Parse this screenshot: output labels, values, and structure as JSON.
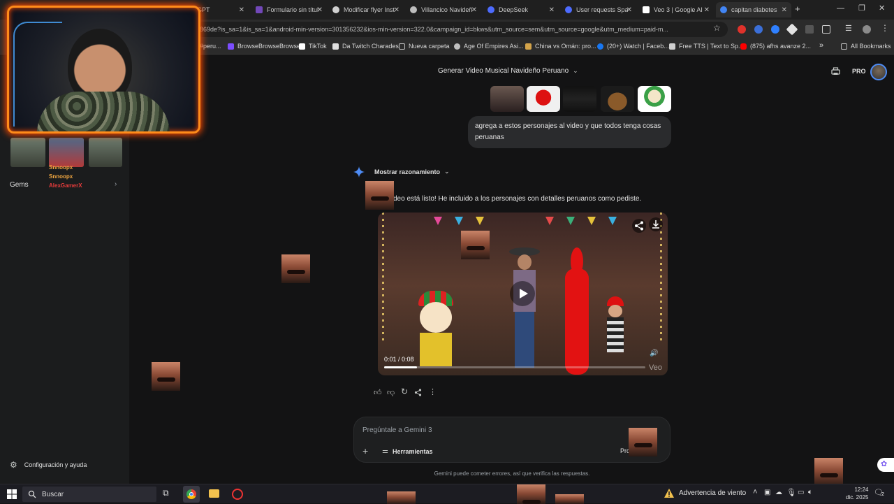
{
  "tabs": [
    {
      "title": "GPT",
      "color": "#444444"
    },
    {
      "title": "Formulario sin título",
      "color": "#7248b9"
    },
    {
      "title": "Modificar flyer Instagram",
      "color": "#d0d0d0"
    },
    {
      "title": "Villancico Navideño",
      "color": "#bdbdbd"
    },
    {
      "title": "DeepSeek",
      "color": "#4d6bfe"
    },
    {
      "title": "User requests Spanish",
      "color": "#4d6bfe"
    },
    {
      "title": "Veo 3 | Google AI",
      "color": "#ffffff"
    },
    {
      "title": "capitan diabetes",
      "color": "#4285f4"
    }
  ],
  "new_tab": "+",
  "address": "869de?is_sa=1&is_sa=1&android-min-version=301356232&ios-min-version=322.0&campaign_id=bkws&utm_source=sem&utm_source=google&utm_medium=paid-m...",
  "bookmarks": [
    {
      "label": "#peru...",
      "color": "#888888"
    },
    {
      "label": "BrowseBrowseBrowse",
      "color": "#7c4dff"
    },
    {
      "label": "TikTok",
      "color": "#ffffff"
    },
    {
      "label": "Da Twitch Charades",
      "color": "#e0e0e0"
    },
    {
      "label": "Nueva carpeta",
      "color": "#bdbdbd"
    },
    {
      "label": "Age Of Empires Asi...",
      "color": "#c0c0c0"
    },
    {
      "label": "China vs Omán: pro...",
      "color": "#d3a34a"
    },
    {
      "label": "(20+) Watch | Faceb...",
      "color": "#1877f2"
    },
    {
      "label": "Free TTS | Text to Sp...",
      "color": "#cfcfcf"
    },
    {
      "label": "(875) afhs avanze 2...",
      "color": "#ff0000"
    }
  ],
  "bookmarks_more": "»",
  "all_bookmarks": "All Bookmarks",
  "sidebar": {
    "gems_label": "Gems",
    "settings_label": "Configuración y ayuda",
    "chat_overlay": [
      {
        "name": "Snnoopx",
        "color": "#f0a640"
      },
      {
        "name": "Snnoopx",
        "color": "#f0a640"
      },
      {
        "name": "AlexGamerX",
        "color": "#e33b3b"
      }
    ]
  },
  "header": {
    "title": "Generar Video Musical Navideño Peruano",
    "pro_label": "PRO"
  },
  "conversation": {
    "user_message": "agrega a estos personajes al video y que todos tenga cosas peruanas",
    "reasoning_toggle": "Mostrar razonamiento",
    "response": "deo está listo! He incluido a los personajes con detalles peruanos como pediste.",
    "video": {
      "time": "0:01 / 0:08",
      "progress": 0.125,
      "watermark": "Veo"
    }
  },
  "input": {
    "placeholder": "Pregúntale a Gemini 3",
    "tools_label": "Herramientas",
    "mode_label": "Pro"
  },
  "disclaimer": "Gemini puede cometer errores, así que verifica las respuestas.",
  "taskbar": {
    "search_label": "Buscar",
    "weather_label": "Advertencia de viento",
    "time": "12:24",
    "date": "dic. 2025",
    "notif_count": "2"
  },
  "colors": {
    "accent_orange": "#ff8c1a",
    "gemini_blue": "#4e8cf5",
    "background": "#131314"
  }
}
